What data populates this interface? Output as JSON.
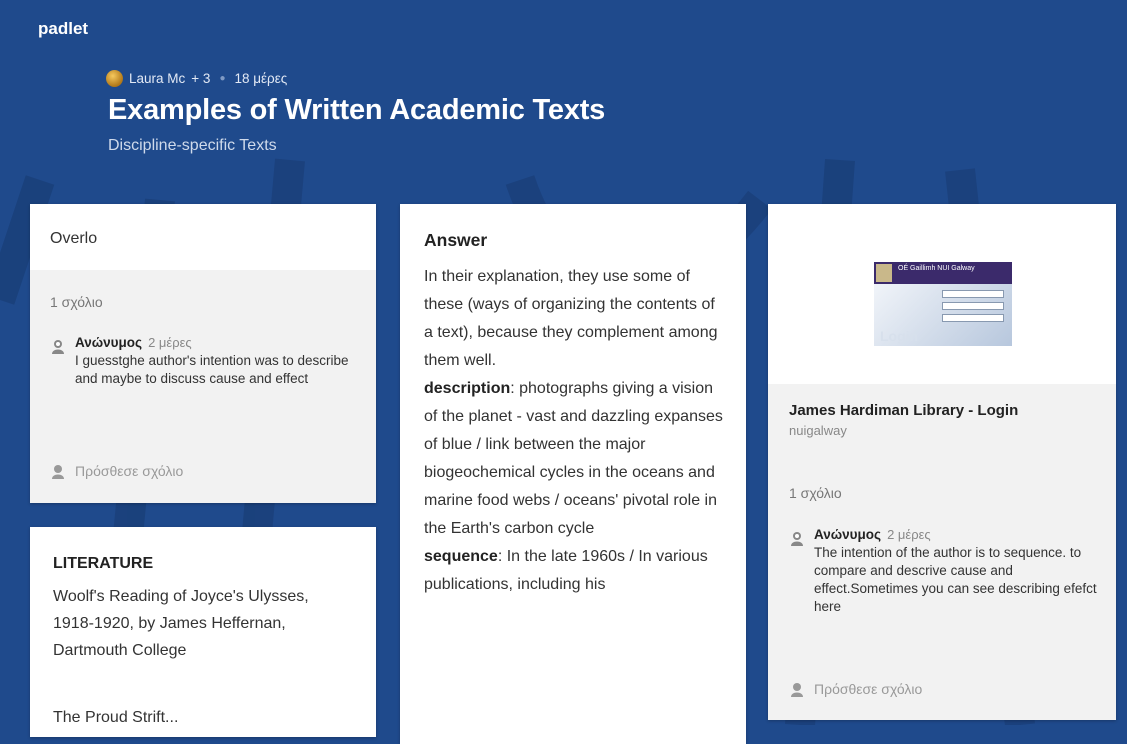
{
  "brand": "padlet",
  "header": {
    "author": "Laura Mc",
    "contributors": "+ 3",
    "age": "18 μέρες",
    "title": "Examples of Written Academic Texts",
    "subtitle": "Discipline-specific Texts"
  },
  "posts": [
    {
      "title": "Overlo",
      "comment_count": "1 σχόλιο",
      "comment": {
        "author": "Ανώνυμος",
        "ago": "2 μέρες",
        "text": "I guesstghe author's intention was to describe and maybe to discuss cause and effect"
      },
      "add_comment": "Πρόσθεσε σχόλιο"
    },
    {
      "title": "LITERATURE",
      "body": "Woolf's Reading of Joyce's Ulysses, 1918-1920, by James Heffernan, Dartmouth College",
      "more": "The Proud Strift..."
    },
    {
      "title": "Answer",
      "intro": "In their explanation, they use some  of these (ways of organizing the contents of a text), because they complement among them well.",
      "description_label": "description",
      "description_text": ": photographs giving a vision of the planet - vast and dazzling expanses of blue / link between the major biogeochemical cycles in the oceans and marine food webs / oceans' pivotal role in the Earth's carbon cycle",
      "sequence_label": "sequence",
      "sequence_text": ": In the late 1960s / In various publications, including his"
    },
    {
      "thumbnail_caption": "Login",
      "thumbnail_header": "OÉ Gaillimh NUI Galway",
      "link_title": "James Hardiman Library - Login",
      "link_source": "nuigalway",
      "comment_count": "1 σχόλιο",
      "comment": {
        "author": "Ανώνυμος",
        "ago": "2 μέρες",
        "text": "The intention of the author is to sequence. to compare and descrive cause and effect.Sometimes you can see describing efefct here"
      },
      "add_comment": "Πρόσθεσε σχόλιο"
    }
  ],
  "colors": {
    "background": "#1f4a8c",
    "card": "#ffffff",
    "comment_area": "#f2f2f2"
  }
}
